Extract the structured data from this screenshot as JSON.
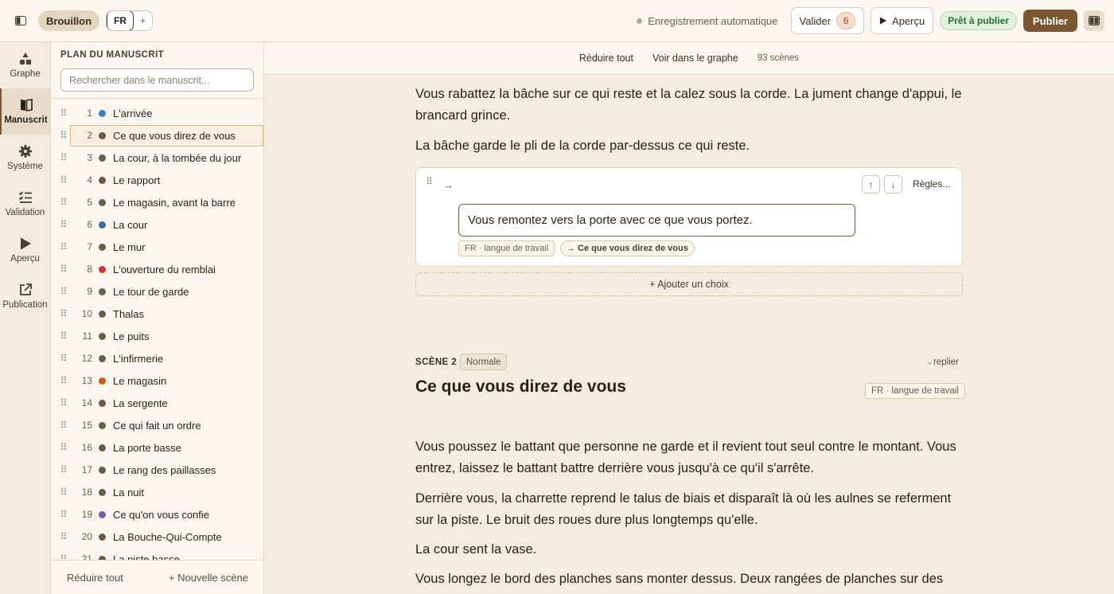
{
  "topbar": {
    "status_pill": "Brouillon",
    "lang_current": "FR",
    "lang_add": "+",
    "autosave": "Enregistrement automatique",
    "validate_label": "Valider",
    "validate_count": "6",
    "preview_label": "Aperçu",
    "ready_label": "Prêt à publier",
    "publish_label": "Publier"
  },
  "rail": [
    {
      "label": "Graphe",
      "icon": "graph-icon"
    },
    {
      "label": "Manuscrit",
      "icon": "book-icon",
      "active": true
    },
    {
      "label": "Système",
      "icon": "gear-icon"
    },
    {
      "label": "Validation",
      "icon": "checklist-icon"
    },
    {
      "label": "Aperçu",
      "icon": "play-icon"
    },
    {
      "label": "Publication",
      "icon": "external-link-icon"
    }
  ],
  "outline": {
    "title": "PLAN DU MANUSCRIT",
    "search_placeholder": "Rechercher dans le manuscrit...",
    "scenes": [
      {
        "num": "1",
        "title": "L'arrivée",
        "color": "#4a7ab5"
      },
      {
        "num": "2",
        "title": "Ce que vous direz de vous",
        "color": "#6b5a45",
        "selected": true
      },
      {
        "num": "3",
        "title": "La cour, à la tombée du jour",
        "color": "#6b5a45"
      },
      {
        "num": "4",
        "title": "Le rapport",
        "color": "#6b5a45"
      },
      {
        "num": "5",
        "title": "Le magasin, avant la barre",
        "color": "#6b5a45"
      },
      {
        "num": "6",
        "title": "La cour",
        "color": "#3f6aa0"
      },
      {
        "num": "7",
        "title": "Le mur",
        "color": "#6b5a45"
      },
      {
        "num": "8",
        "title": "L'ouverture du remblai",
        "color": "#c83a32"
      },
      {
        "num": "9",
        "title": "Le tour de garde",
        "color": "#6b5a45"
      },
      {
        "num": "10",
        "title": "Thalas",
        "color": "#6b5a45"
      },
      {
        "num": "11",
        "title": "Le puits",
        "color": "#6b5a45"
      },
      {
        "num": "12",
        "title": "L'infirmerie",
        "color": "#6b5a45"
      },
      {
        "num": "13",
        "title": "Le magasin",
        "color": "#c0601f"
      },
      {
        "num": "14",
        "title": "La sergente",
        "color": "#6b5a45"
      },
      {
        "num": "15",
        "title": "Ce qui fait un ordre",
        "color": "#6b5a45"
      },
      {
        "num": "16",
        "title": "La porte basse",
        "color": "#6b5a45"
      },
      {
        "num": "17",
        "title": "Le rang des paillasses",
        "color": "#6b5a45"
      },
      {
        "num": "18",
        "title": "La nuit",
        "color": "#6b5a45"
      },
      {
        "num": "19",
        "title": "Ce qu'on vous confie",
        "color": "#7a5aa6"
      },
      {
        "num": "20",
        "title": "La Bouche-Qui-Compte",
        "color": "#6b5a45"
      },
      {
        "num": "21",
        "title": "La piste basse",
        "color": "#6b5a45"
      }
    ],
    "collapse_all": "Réduire tout",
    "new_scene": "+ Nouvelle scène"
  },
  "main_toolbar": {
    "collapse_all": "Réduire tout",
    "view_graph": "Voir dans le graphe",
    "scene_count": "93 scènes"
  },
  "prev_scene": {
    "paragraphs": [
      "Vous rabattez la bâche sur ce qui reste et la calez sous la corde. La jument change d'appui, le brancard grince.",
      "La bâche garde le pli de la corde par-dessus ce qui reste."
    ],
    "choice": {
      "arrow": "→",
      "rules": "Règles...",
      "text": "Vous remontez vers la porte avec ce que vous portez.",
      "lang_tag": "FR · langue de travail",
      "target_tag": "→ Ce que vous direz de vous"
    },
    "add_choice": "+ Ajouter un choix"
  },
  "scene": {
    "label": "SCÈNE 2",
    "type": "Normale",
    "fold": "˗ replier",
    "title": "Ce que vous direz de vous",
    "lang": "FR · langue de travail",
    "paragraphs": [
      "Vous poussez le battant que personne ne garde et il revient tout seul contre le montant. Vous entrez, laissez le battant battre derrière vous jusqu'à ce qu'il s'arrête.",
      "Derrière vous, la charrette reprend le talus de biais et disparaît là où les aulnes se referment sur la piste. Le bruit des roues dure plus longtemps qu'elle.",
      "La cour sent la vase.",
      "Vous longez le bord des planches sans monter dessus. Deux rangées de planches sur des"
    ]
  }
}
